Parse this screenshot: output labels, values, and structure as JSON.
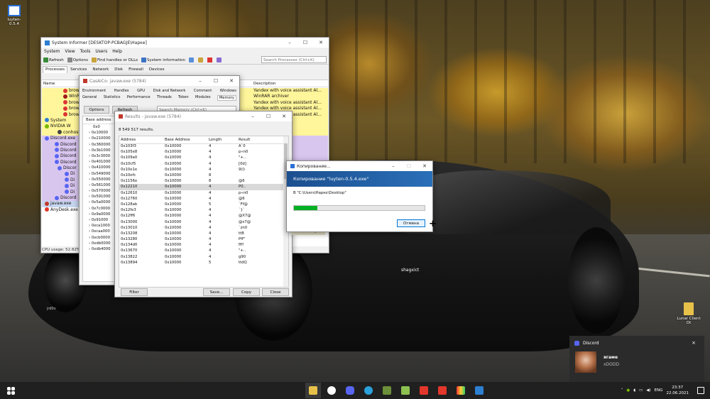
{
  "desktop": {
    "icons": [
      {
        "name": "luyten-icon",
        "label": "luyten-0.5.4"
      },
      {
        "name": "lunar-client-icon",
        "label": "Lunar Client",
        "sub": "Ot"
      }
    ],
    "shadow_text": [
      "shagxict",
      "jrd0v"
    ]
  },
  "system_informer": {
    "title": "System Informer [DESKTOP-PCBAGJE\\Наркe]",
    "menu": [
      "System",
      "View",
      "Tools",
      "Users",
      "Help"
    ],
    "toolbar": {
      "refresh": "Refresh",
      "options": "Options",
      "find": "Find handles or DLLs",
      "sysinfo": "System information"
    },
    "search_placeholder": "Search Processes (Ctrl+K)",
    "tabs": [
      "Processes",
      "Services",
      "Network",
      "Disk",
      "Firewall",
      "Devices"
    ],
    "col_name": "Name",
    "col_description": "Description",
    "processes": [
      "brow",
      "WinR",
      "brow",
      "brow",
      "brow",
      "System",
      "NVIDIA W",
      "conhost",
      "Discord.exe",
      "Discord",
      "Discord",
      "Discord",
      "Discord",
      "Discor",
      "Di",
      "Di",
      "Di",
      "Di",
      "Discord",
      "javaw.exe",
      "AnyDesk.exe"
    ],
    "descriptions": [
      "Yandex with voice assistant Al...",
      "WinRAR archiver",
      "Yandex with voice assistant Al...",
      "Yandex with voice assistant Al...",
      "Yandex with voice assistant Al...",
      "",
      "",
      "",
      "",
      "",
      "",
      "",
      "Service",
      "ice"
    ],
    "cpu_usage": "CPU usage: 52.82%"
  },
  "props": {
    "title": "CasAiCo: javaw.exe (5784)",
    "tabs_row1": [
      "Environment",
      "Handles",
      "GPU",
      "Disk and Network",
      "Comment",
      "Windows"
    ],
    "tabs_row2": [
      "General",
      "Statistics",
      "Performance",
      "Threads",
      "Token",
      "Modules",
      "Memory"
    ],
    "options": "Options",
    "refresh": "Refresh",
    "search_placeholder": "Search Memory (Ctrl+K)",
    "col_base": "Base address",
    "addresses": [
      "0x0",
      "0x10000",
      "0x210000",
      "0x360000",
      "0x3b1000",
      "0x3c3000",
      "0x401000",
      "0x410000",
      "0x549000",
      "0x550000",
      "0x561000",
      "0x570000",
      "0x591000",
      "0x5a0000",
      "0x7c0000",
      "0x9a0000",
      "0x91000",
      "0xca1000",
      "0xcaa000",
      "0xcb0000",
      "0xdb0000",
      "0xdb4000"
    ]
  },
  "results": {
    "title": "Results - javaw.exe (5784)",
    "count": "8 549 517 results.",
    "columns": [
      "Address",
      "Base Address",
      "Length",
      "Result"
    ],
    "rows": [
      [
        "0x103f3",
        "0x10000",
        "4",
        "A`0"
      ],
      [
        "0x105e8",
        "0x10000",
        "4",
        "p«n0"
      ],
      [
        "0x109a0",
        "0x10000",
        "4",
        "\"+.."
      ],
      [
        "0x10cf5",
        "0x10000",
        "4",
        "[0d]"
      ],
      [
        "0x10e1e",
        "0x10000",
        "4",
        "9(l)"
      ],
      [
        "0x10efc",
        "0x10000",
        "8",
        ""
      ],
      [
        "0x1156e",
        "0x10000",
        "8",
        "@6"
      ],
      [
        "0x12210",
        "0x10000",
        "4",
        "P0.."
      ],
      [
        "0x12610",
        "0x10000",
        "4",
        "p«n0"
      ],
      [
        "0x12760",
        "0x10000",
        "4",
        "@6"
      ],
      [
        "0x128ab",
        "0x10000",
        "5",
        "`Ff@"
      ],
      [
        "0x12fe3",
        "0x10000",
        "4",
        "`}`"
      ],
      [
        "0x12ff6",
        "0x10000",
        "4",
        "@X7@"
      ],
      [
        "0x13000",
        "0x10000",
        "4",
        "@x7@"
      ],
      [
        "0x13010",
        "0x10000",
        "4",
        "`zn0"
      ],
      [
        "0x13208",
        "0x10000",
        "4",
        "ttB"
      ],
      [
        "0x13280",
        "0x10000",
        "4",
        "Pff\""
      ],
      [
        "0x134d0",
        "0x10000",
        "4",
        "fff!"
      ],
      [
        "0x13670",
        "0x10000",
        "4",
        "\"+.."
      ],
      [
        "0x13822",
        "0x10000",
        "4",
        "g90"
      ],
      [
        "0x13894",
        "0x10000",
        "5",
        "ttdQ"
      ]
    ],
    "buttons": {
      "filter": "Filter",
      "save": "Save...",
      "copy": "Copy",
      "close": "Close"
    }
  },
  "copy_dialog": {
    "title": "Копирование...",
    "heading": "Копирование \"luyten-0.5.4.exe\"",
    "path": "В \"C:\\Users\\Наркe\\Desktop\"",
    "progress": 0.18,
    "cancel": "Отмена"
  },
  "overlay_text": "Ext Binary",
  "notification": {
    "app": "Discord",
    "user": "ягаме",
    "message": "xDODD",
    "close": "×"
  },
  "taskbar": {
    "lang": "ENG",
    "time": "23:37",
    "date": "22.06.2021"
  }
}
